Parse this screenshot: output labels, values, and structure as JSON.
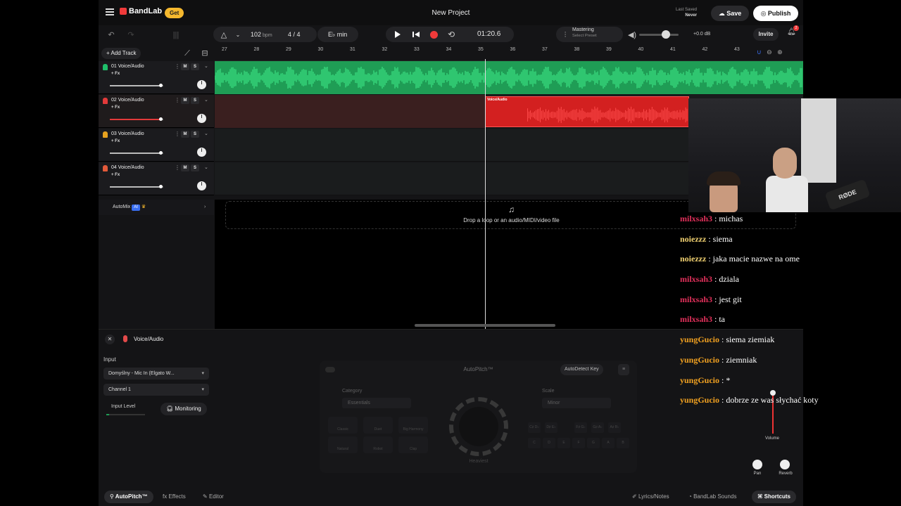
{
  "header": {
    "brand": "BandLab",
    "get_label": "Get",
    "project_title": "New Project",
    "last_saved_label": "Last Saved",
    "last_saved_value": "Never",
    "save_label": "Save",
    "publish_label": "Publish"
  },
  "transport": {
    "bpm": "102",
    "bpm_unit": "bpm",
    "time_sig_num": "4",
    "time_sig_den": "4",
    "key": "E♭ min",
    "time": "01:20.6",
    "mastering_label": "Mastering",
    "mastering_preset": "Select Preset",
    "master_volume_db": "+0.0 dB",
    "invite_label": "Invite",
    "notifications_count": "2"
  },
  "tracks_header": {
    "add_track_label": "Add Track",
    "ruler": [
      "27",
      "28",
      "29",
      "30",
      "31",
      "32",
      "33",
      "34",
      "35",
      "36",
      "37",
      "38",
      "39",
      "40",
      "41",
      "42",
      "43"
    ]
  },
  "tracks": [
    {
      "name": "01 Voice/Audio",
      "fx": "+ Fx",
      "m": "M",
      "s": "S",
      "icon_color": "#1fbf6a",
      "volume": 0.95
    },
    {
      "name": "02 Voice/Audio",
      "fx": "+ Fx",
      "m": "M",
      "s": "S",
      "icon_color": "#e33a3a",
      "volume": 0.95
    },
    {
      "name": "03 Voice/Audio",
      "fx": "+ Fx",
      "m": "M",
      "s": "S",
      "icon_color": "#e6a21f",
      "volume": 0.95
    },
    {
      "name": "04 Voice/Audio",
      "fx": "+ Fx",
      "m": "M",
      "s": "S",
      "icon_color": "#e35a3a",
      "volume": 0.95
    }
  ],
  "clip": {
    "label": "Voice/Audio"
  },
  "automix": {
    "label": "AutoMix",
    "ai": "AI"
  },
  "drop_zone": {
    "text": "Drop a loop or an audio/MIDI/video file"
  },
  "bottom_panel": {
    "title": "Voice/Audio",
    "input_label": "Input",
    "input_device": "Domyślny - Mic In (Elgato W...",
    "channel": "Channel 1",
    "input_level_label": "Input Level",
    "monitoring_label": "Monitoring",
    "autopitch_title": "AutoPitch™",
    "autodetect_label": "AutoDetect Key",
    "category_label": "Category",
    "category_value": "Essentials",
    "scale_label": "Scale",
    "scale_value": "Minor",
    "knob_label": "Heaviest",
    "presets": [
      "Classic",
      "Duet",
      "Big Harmony",
      "Natural",
      "Robot",
      "Clap"
    ],
    "notes": [
      "C♯ D♭",
      "D♯ E♭",
      "F♯ G♭",
      "G♯ A♭",
      "A♯ B♭",
      "C",
      "D",
      "E",
      "F",
      "G",
      "A",
      "B"
    ],
    "volume_label": "Volume",
    "pan_label": "Pan",
    "reverb_label": "Reverb",
    "tabs": {
      "autopitch": "AutoPitch™",
      "effects": "Effects",
      "editor": "Editor",
      "lyrics": "Lyrics/Notes",
      "sounds": "BandLab Sounds",
      "shortcuts": "Shortcuts"
    }
  },
  "chat": [
    {
      "user": "milxsah3",
      "text": " : michas",
      "color": "#e0305a"
    },
    {
      "user": "noiezzz",
      "text": " : siema",
      "color": "#f0d070"
    },
    {
      "user": "noiezzz",
      "text": " : jaka macie nazwe na ome",
      "color": "#f0d070"
    },
    {
      "user": "milxsah3",
      "text": " : dziala",
      "color": "#e0305a"
    },
    {
      "user": "milxsah3",
      "text": " : jest git",
      "color": "#e0305a"
    },
    {
      "user": "milxsah3",
      "text": " : ta",
      "color": "#e0305a"
    },
    {
      "user": "yungGucio",
      "text": " : siema ziemiak",
      "color": "#f0a020"
    },
    {
      "user": "yungGucio",
      "text": " : ziemniak",
      "color": "#f0a020"
    },
    {
      "user": "yungGucio",
      "text": " : *",
      "color": "#f0a020"
    },
    {
      "user": "yungGucio",
      "text": " : dobrze ze was słychać koty",
      "color": "#f0a020"
    }
  ],
  "webcam": {
    "mic_brand": "RØDE"
  }
}
